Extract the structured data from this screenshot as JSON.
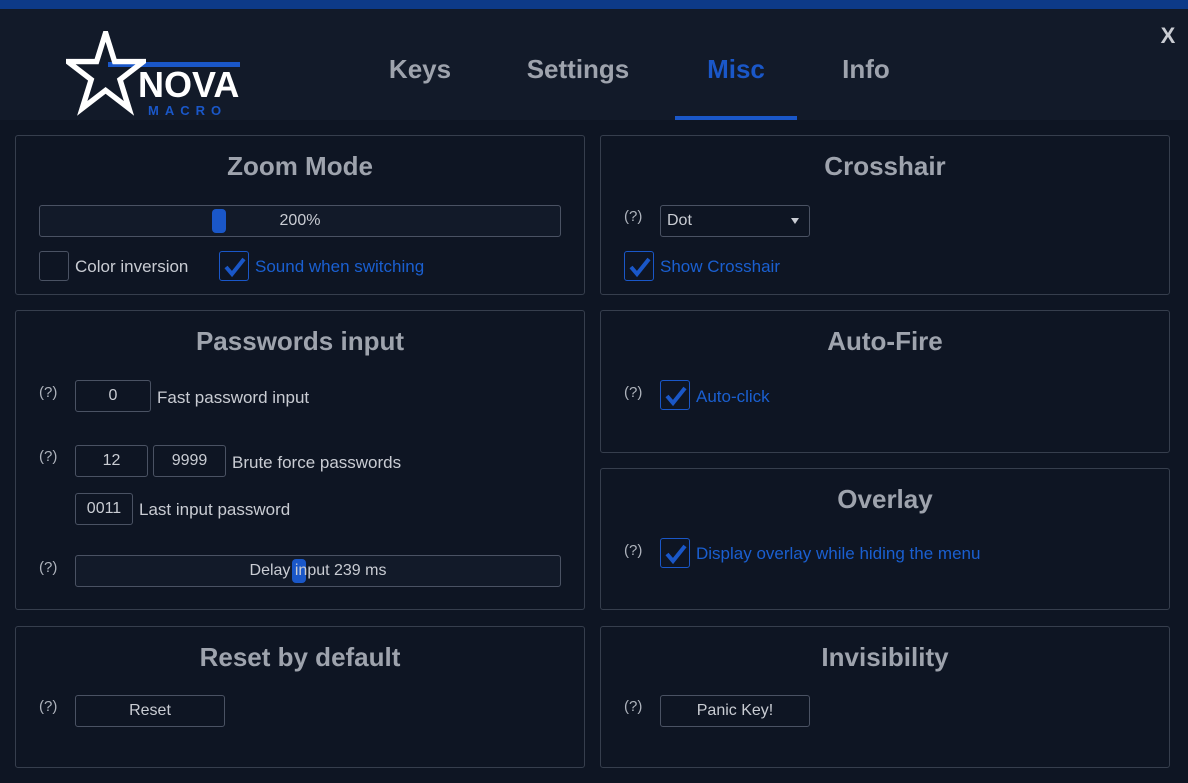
{
  "window": {
    "close_label": "X"
  },
  "logo": {
    "name": "NOVA",
    "subtitle": "MACRO"
  },
  "tabs": [
    {
      "label": "Keys",
      "active": false
    },
    {
      "label": "Settings",
      "active": false
    },
    {
      "label": "Misc",
      "active": true
    },
    {
      "label": "Info",
      "active": false
    }
  ],
  "colors": {
    "accent": "#1a57c8",
    "background": "#0e1523",
    "header": "#121a29",
    "text": "#c9ccd3"
  },
  "help_label": "(?)",
  "zoom_mode": {
    "title": "Zoom Mode",
    "zoom_value": "200%",
    "zoom_level_fraction": 0.34,
    "color_inversion": {
      "label": "Color inversion",
      "checked": false
    },
    "sound_when_switching": {
      "label": "Sound when switching",
      "checked": true
    }
  },
  "passwords_input": {
    "title": "Passwords input",
    "fast_password": {
      "value": "0",
      "label": "Fast password input"
    },
    "brute_force": {
      "from": "12",
      "to": "9999",
      "label": "Brute force passwords"
    },
    "last_input": {
      "value": "0011",
      "label": "Last input password"
    },
    "delay": {
      "label": "Delay input 239 ms",
      "level_fraction": 0.46
    }
  },
  "reset_by_default": {
    "title": "Reset by default",
    "button_label": "Reset"
  },
  "crosshair": {
    "title": "Crosshair",
    "selected": "Dot",
    "show_crosshair": {
      "label": "Show Crosshair",
      "checked": true
    }
  },
  "auto_fire": {
    "title": "Auto-Fire",
    "auto_click": {
      "label": "Auto-click",
      "checked": true
    }
  },
  "overlay": {
    "title": "Overlay",
    "display_overlay": {
      "label": "Display overlay while hiding the menu",
      "checked": true
    }
  },
  "invisibility": {
    "title": "Invisibility",
    "button_label": "Panic Key!"
  }
}
